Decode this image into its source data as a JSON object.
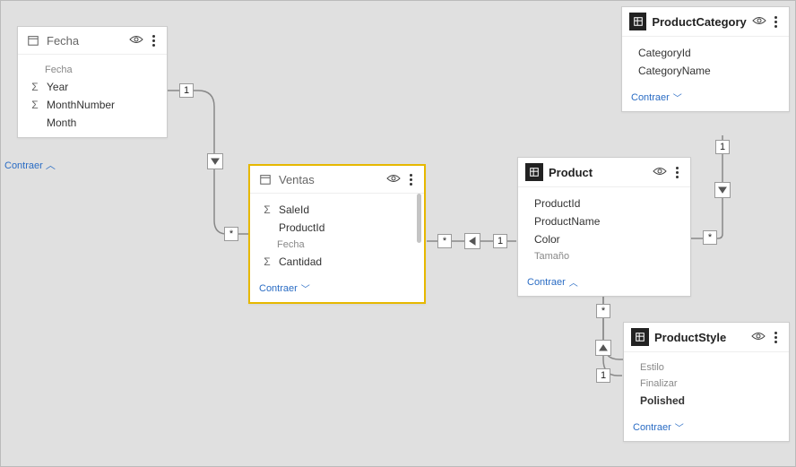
{
  "collapse_label": "Contraer",
  "tables": {
    "fecha": {
      "title": "Fecha",
      "fields": [
        {
          "label": "Fecha",
          "muted": true,
          "sigma": false
        },
        {
          "label": "Year",
          "muted": false,
          "sigma": true
        },
        {
          "label": "MonthNumber",
          "muted": false,
          "sigma": true
        },
        {
          "label": "Month",
          "muted": false,
          "sigma": false
        }
      ]
    },
    "ventas": {
      "title": "Ventas",
      "fields": [
        {
          "label": "SaleId",
          "muted": false,
          "sigma": true
        },
        {
          "label": "ProductId",
          "muted": false,
          "sigma": false
        },
        {
          "label": "Fecha",
          "muted": true,
          "sigma": false
        },
        {
          "label": "Cantidad",
          "muted": false,
          "sigma": true
        }
      ]
    },
    "product": {
      "title": "Product",
      "fields": [
        {
          "label": "ProductId",
          "muted": false,
          "sigma": false
        },
        {
          "label": "ProductName",
          "muted": false,
          "sigma": false
        },
        {
          "label": "Color",
          "muted": false,
          "sigma": false
        },
        {
          "label": "Tamaño",
          "muted": true,
          "sigma": false
        }
      ]
    },
    "productcategory": {
      "title": "ProductCategory",
      "fields": [
        {
          "label": "CategoryId",
          "muted": false,
          "sigma": false
        },
        {
          "label": "CategoryName",
          "muted": false,
          "sigma": false
        }
      ]
    },
    "productstyle": {
      "title": "ProductStyle",
      "fields": [
        {
          "label": "Estilo",
          "muted": true,
          "sigma": false
        },
        {
          "label": "Finalizar",
          "muted": true,
          "sigma": false
        },
        {
          "label": "Polished",
          "muted": false,
          "sigma": false
        }
      ]
    }
  },
  "relationships": [
    {
      "from": "fecha",
      "to": "ventas",
      "from_card": "1",
      "to_card": "*"
    },
    {
      "from": "ventas",
      "to": "product",
      "from_card": "*",
      "to_card": "1"
    },
    {
      "from": "product",
      "to": "productcategory",
      "from_card": "*",
      "to_card": "1"
    },
    {
      "from": "product",
      "to": "productstyle",
      "from_card": "*",
      "to_card": "1"
    }
  ]
}
